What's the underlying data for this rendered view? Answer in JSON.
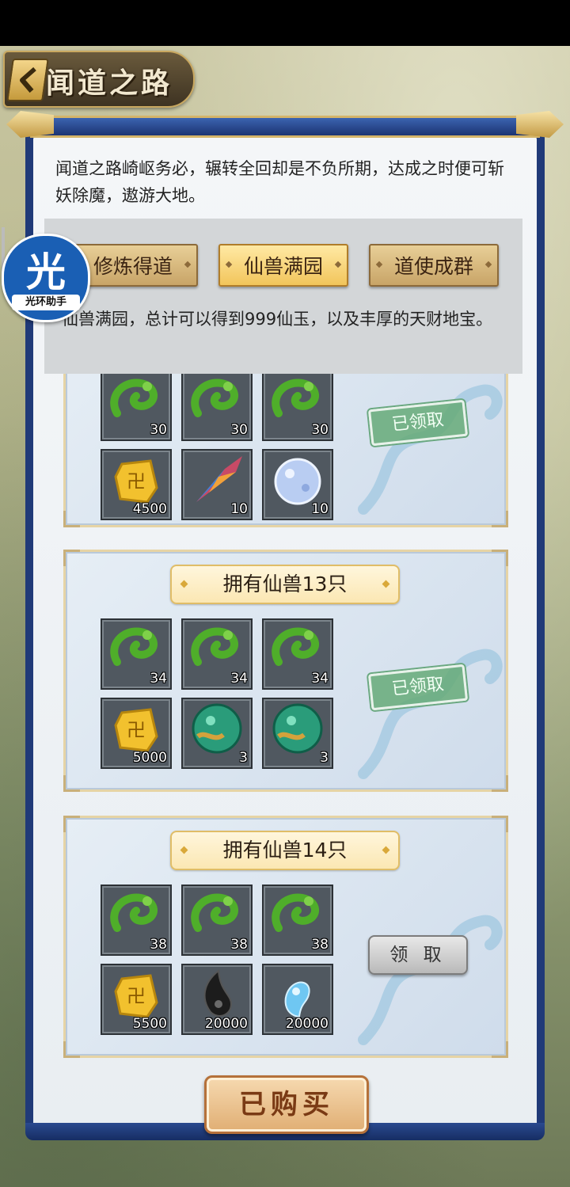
{
  "header": {
    "title": "闻道之路"
  },
  "intro": "闻道之路崎岖务必，辗转全回却是不负所期，达成之时便可斩妖除魔，遨游大地。",
  "tabs": [
    {
      "label": "修炼得道",
      "active": false
    },
    {
      "label": "仙兽满园",
      "active": true
    },
    {
      "label": "道使成群",
      "active": false
    }
  ],
  "tab_description": "仙兽满园，总计可以得到999仙玉，以及丰厚的天财地宝。",
  "assistant": {
    "glyph": "光",
    "label": "光环助手"
  },
  "cards": [
    {
      "title": "",
      "status": "已领取",
      "items": [
        {
          "icon": "jade-dragon-icon",
          "count": "30"
        },
        {
          "icon": "jade-dragon-icon",
          "count": "30"
        },
        {
          "icon": "jade-dragon-icon",
          "count": "30"
        },
        {
          "icon": "gold-ingot-icon",
          "count": "4500"
        },
        {
          "icon": "crystal-shard-icon",
          "count": "10"
        },
        {
          "icon": "spirit-orb-icon",
          "count": "10"
        }
      ]
    },
    {
      "title": "拥有仙兽13只",
      "status": "已领取",
      "items": [
        {
          "icon": "jade-dragon-icon",
          "count": "34"
        },
        {
          "icon": "jade-dragon-icon",
          "count": "34"
        },
        {
          "icon": "jade-dragon-icon",
          "count": "34"
        },
        {
          "icon": "gold-ingot-icon",
          "count": "5000"
        },
        {
          "icon": "green-pearl-icon",
          "count": "3"
        },
        {
          "icon": "green-pearl-icon",
          "count": "3"
        }
      ]
    },
    {
      "title": "拥有仙兽14只",
      "button": "领 取",
      "items": [
        {
          "icon": "jade-dragon-icon",
          "count": "38"
        },
        {
          "icon": "jade-dragon-icon",
          "count": "38"
        },
        {
          "icon": "jade-dragon-icon",
          "count": "38"
        },
        {
          "icon": "gold-ingot-icon",
          "count": "5500"
        },
        {
          "icon": "black-drop-icon",
          "count": "20000"
        },
        {
          "icon": "blue-drop-icon",
          "count": "20000"
        }
      ]
    }
  ],
  "footer": {
    "purchased_label": "已购买"
  },
  "colors": {
    "panel_blue": "#203a78",
    "tab_active": "#f2c55b",
    "claimed_green": "#66aa78"
  }
}
